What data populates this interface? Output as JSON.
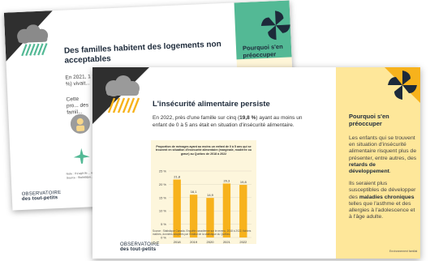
{
  "back_slide": {
    "title": "Des familles habitent des logements non acceptables",
    "text_1": "En 2021, 1 famille sur 4 avec au moins un enfant de 0 à 5 ans (25, 7 %) vivait...",
    "text_2": "Cette pro... des famil...",
    "panel_title": "Pourquoi s'en préoccuper",
    "note": "Note : Il s'agit de ... et les ménages ... Source : Statistique...",
    "logo_line1": "OBSERVATOIRE",
    "logo_line2": "des tout-petits"
  },
  "front_slide": {
    "title": "L'insécurité alimentaire persiste",
    "lead_1": "En 2022, près d'une famille sur cinq (",
    "lead_highlight": "19,8 %",
    "lead_2": ") ayant au moins un enfant de 0 à 5 ans était en situation d'insécurité alimentaire.",
    "panel_title": "Pourquoi s'en préoccuper",
    "panel_p1_a": "Les enfants qui se trouvent en situation d'insécurité alimentaire risquent plus de présenter, entre autres, des ",
    "panel_p1_b": "retards de développement",
    "panel_p1_c": ".",
    "panel_p2_a": "Ils seraient plus susceptibles de développer des ",
    "panel_p2_b": "maladies chroniques",
    "panel_p2_c": " telles que l'asthme et des allergies à l'adolescence et à l'âge adulte.",
    "panel_footer": "Environnement familial",
    "logo_line1": "OBSERVATOIRE",
    "logo_line2": "des tout-petits"
  },
  "chart_data": {
    "type": "bar",
    "title": "Proportion de ménages ayant au moins un enfant de 0 à 5 ans qui se trouvent en situation d'insécurité alimentaire (marginale, modérée ou grave) au Québec de 2018 à 2022",
    "categories": [
      "2018",
      "2019",
      "2020",
      "2021",
      "2022"
    ],
    "values": [
      21.8,
      16.1,
      14.9,
      20.3,
      19.8
    ],
    "value_labels": [
      "21,8",
      "16,1",
      "14,9",
      "20,3",
      "19,8"
    ],
    "yticks": [
      "25 %",
      "20 %",
      "15 %",
      "10 %",
      "5 %",
      "0 %"
    ],
    "ylim": [
      0,
      25
    ],
    "bar_color": "#f7b21c",
    "source": "Source : Statistique Canada. Enquête canadienne sur le revenu, 2018 à 2022, fichiers maîtres, données adaptées par l'Institut de la statistique du Québec."
  },
  "colors": {
    "navy": "#1d2a3a",
    "gold": "#f7b21c",
    "panel_yellow": "#fee79a",
    "green": "#53b995"
  }
}
